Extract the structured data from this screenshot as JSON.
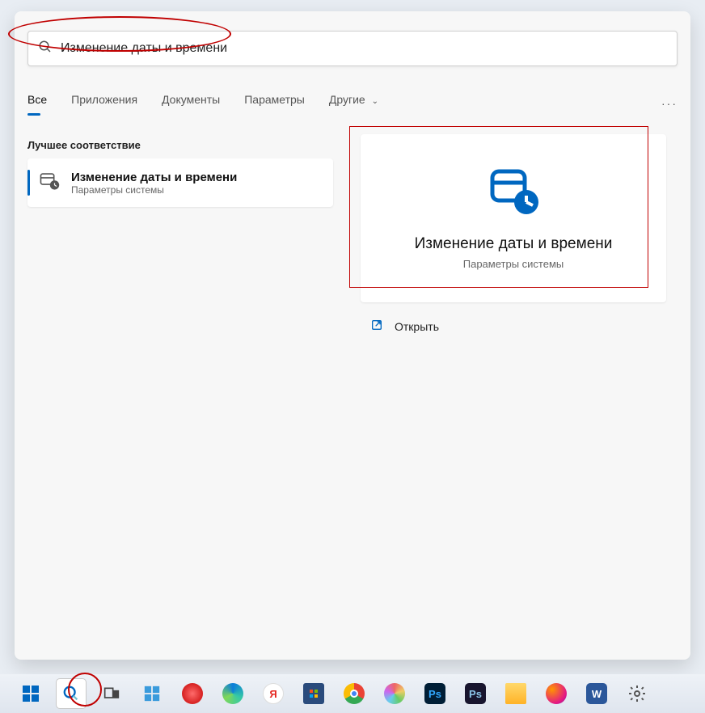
{
  "search": {
    "query": "Изменение даты и времени"
  },
  "tabs": {
    "all": "Все",
    "apps": "Приложения",
    "docs": "Документы",
    "params": "Параметры",
    "other": "Другие"
  },
  "section": {
    "best_match": "Лучшее соответствие"
  },
  "result": {
    "title": "Изменение даты и времени",
    "subtitle": "Параметры системы"
  },
  "detail": {
    "title": "Изменение даты и времени",
    "subtitle": "Параметры системы",
    "open": "Открыть"
  }
}
